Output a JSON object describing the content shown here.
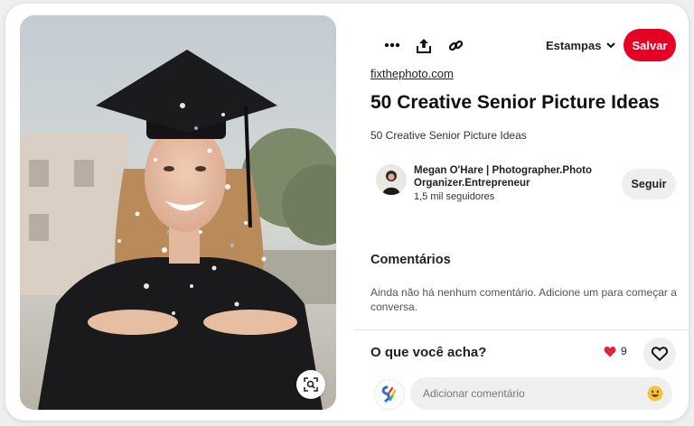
{
  "pin": {
    "source": "fixthephoto.com",
    "title": "50 Creative Senior Picture Ideas",
    "description": "50 Creative Senior Picture Ideas"
  },
  "toolbar": {
    "more_icon": "more-dots-icon",
    "share_icon": "share-upload-icon",
    "link_icon": "link-chain-icon",
    "board_label": "Estampas",
    "save_label": "Salvar",
    "accent_color": "#e60023"
  },
  "creator": {
    "name": "Megan O'Hare | Photographer.Photo Organizer.Entrepreneur",
    "followers": "1,5 mil seguidores",
    "follow_label": "Seguir"
  },
  "comments": {
    "heading": "Comentários",
    "empty_text": "Ainda não há nenhum comentário. Adicione um para começar a conversa."
  },
  "feedback": {
    "question": "O que você acha?",
    "reaction_count": "9"
  },
  "composer": {
    "placeholder": "Adicionar comentário"
  }
}
